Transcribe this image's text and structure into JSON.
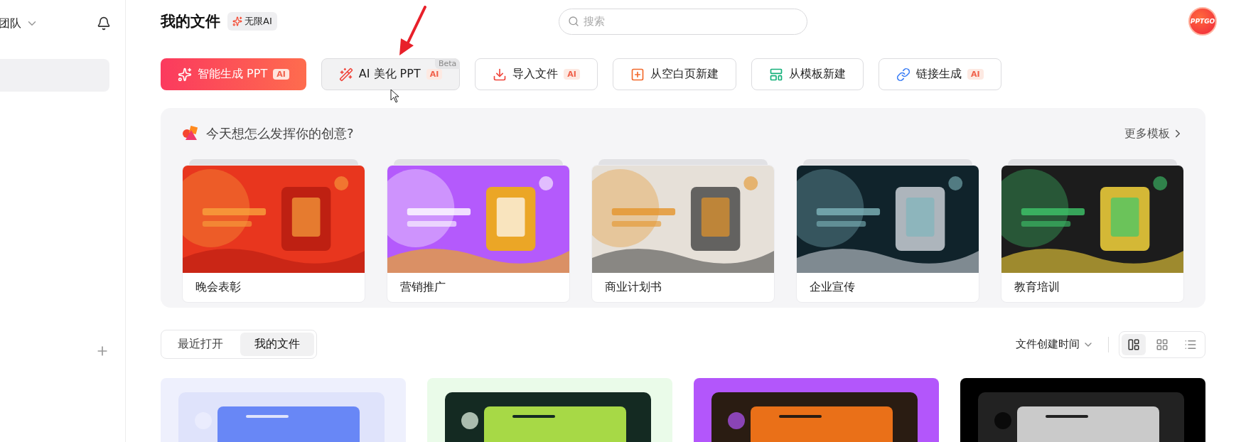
{
  "sidebar": {
    "team_label": "团队",
    "nav_items": [
      {
        "selected": true
      }
    ]
  },
  "header": {
    "title": "我的文件",
    "badge": "无限AI",
    "search": {
      "placeholder": "搜索"
    },
    "avatar": {
      "text": "PPTGO"
    }
  },
  "actions": [
    {
      "kind": "generate",
      "label": "智能生成 PPT",
      "badge": "AI",
      "hovered": false
    },
    {
      "kind": "beautify",
      "label": "AI 美化 PPT",
      "badge": "AI",
      "tag": "Beta",
      "hovered": true
    },
    {
      "kind": "import",
      "label": "导入文件",
      "badge": "AI",
      "hovered": false
    },
    {
      "kind": "blank",
      "label": "从空白页新建",
      "hovered": false
    },
    {
      "kind": "template",
      "label": "从模板新建",
      "hovered": false
    },
    {
      "kind": "link",
      "label": "链接生成",
      "badge": "AI",
      "hovered": false
    }
  ],
  "templates": {
    "title": "今天想怎么发挥你的创意?",
    "more": "更多模板",
    "items": [
      {
        "label": "晚会表彰",
        "kind": "picture"
      },
      {
        "label": "营销推广",
        "kind": "picture"
      },
      {
        "label": "商业计划书",
        "kind": "picture"
      },
      {
        "label": "企业宣传",
        "kind": "picture"
      },
      {
        "label": "教育培训",
        "kind": "picture"
      }
    ]
  },
  "file_tabs": [
    {
      "label": "最近打开",
      "selected": false
    },
    {
      "label": "我的文件",
      "selected": true
    }
  ],
  "sort": {
    "label": "文件创建时间"
  },
  "view_modes": [
    {
      "kind": "cards",
      "selected": true
    },
    {
      "kind": "grid",
      "selected": false
    },
    {
      "kind": "list",
      "selected": false
    }
  ]
}
